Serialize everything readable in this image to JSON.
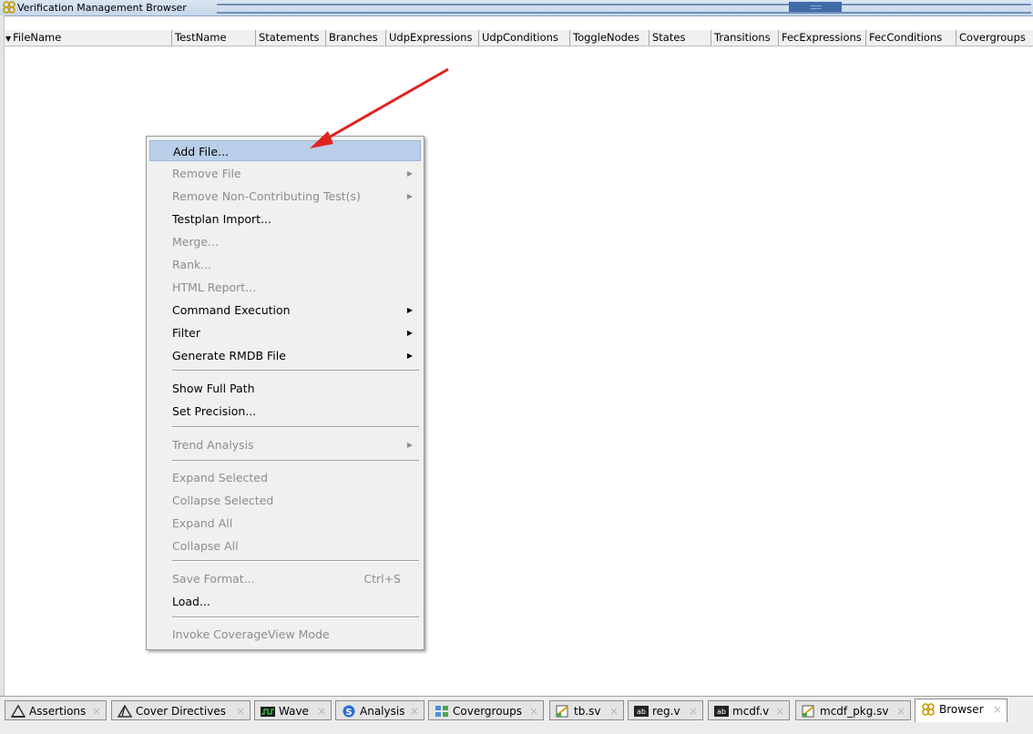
{
  "window": {
    "title": "Verification Management Browser",
    "grip": ":::::::"
  },
  "columns": [
    "FileName",
    "TestName",
    "Statements",
    "Branches",
    "UdpExpressions",
    "UdpConditions",
    "ToggleNodes",
    "States",
    "Transitions",
    "FecExpressions",
    "FecConditions",
    "Covergroups"
  ],
  "context_menu": {
    "items": [
      {
        "label": "Add File...",
        "enabled": true,
        "highlighted": true
      },
      {
        "label": "Remove File",
        "enabled": false,
        "submenu": true
      },
      {
        "label": "Remove Non-Contributing Test(s)",
        "enabled": false,
        "submenu": true
      },
      {
        "label": "Testplan Import...",
        "enabled": true
      },
      {
        "label": "Merge...",
        "enabled": false
      },
      {
        "label": "Rank...",
        "enabled": false
      },
      {
        "label": "HTML Report...",
        "enabled": false
      },
      {
        "label": "Command Execution",
        "enabled": true,
        "submenu": true
      },
      {
        "label": "Filter",
        "enabled": true,
        "submenu": true
      },
      {
        "label": "Generate RMDB File",
        "enabled": true,
        "submenu": true
      },
      {
        "label": "Show Full Path",
        "enabled": true
      },
      {
        "label": "Set Precision...",
        "enabled": true
      },
      {
        "label": "Trend Analysis",
        "enabled": false,
        "submenu": true
      },
      {
        "label": "Expand Selected",
        "enabled": false
      },
      {
        "label": "Collapse Selected",
        "enabled": false
      },
      {
        "label": "Expand All",
        "enabled": false
      },
      {
        "label": "Collapse All",
        "enabled": false
      },
      {
        "label": "Save Format...",
        "enabled": false,
        "shortcut": "Ctrl+S"
      },
      {
        "label": "Load...",
        "enabled": true
      },
      {
        "label": "Invoke CoverageView Mode",
        "enabled": false
      }
    ]
  },
  "tabs": [
    {
      "label": "Assertions",
      "icon": "assertion-icon"
    },
    {
      "label": "Cover Directives",
      "icon": "cover-directive-icon"
    },
    {
      "label": "Wave",
      "icon": "wave-icon"
    },
    {
      "label": "Analysis",
      "icon": "analysis-icon"
    },
    {
      "label": "Covergroups",
      "icon": "covergroups-icon"
    },
    {
      "label": "tb.sv",
      "icon": "source-file-icon"
    },
    {
      "label": "reg.v",
      "icon": "verilog-file-icon"
    },
    {
      "label": "mcdf.v",
      "icon": "verilog-file-icon"
    },
    {
      "label": "mcdf_pkg.sv",
      "icon": "source-file-icon"
    },
    {
      "label": "Browser",
      "icon": "browser-icon",
      "active": true
    }
  ],
  "tab_close_glyph": "×",
  "colors": {
    "highlight": "#b9cfe9",
    "arrow": "#e0231f",
    "titlebar": "#c6d6ea"
  }
}
